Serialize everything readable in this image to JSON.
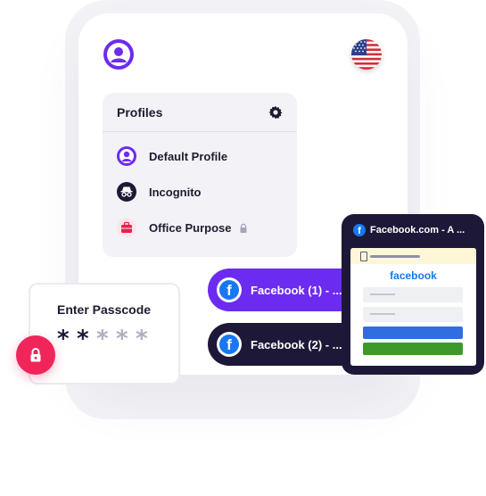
{
  "profiles": {
    "title": "Profiles",
    "items": [
      {
        "label": "Default Profile",
        "icon": "user-icon",
        "locked": false
      },
      {
        "label": "Incognito",
        "icon": "incognito-icon",
        "locked": false
      },
      {
        "label": "Office Purpose",
        "icon": "briefcase-icon",
        "locked": true
      }
    ]
  },
  "tabs": [
    {
      "label": "Facebook (1) - ...",
      "color": "#6c2bf0",
      "icon": "facebook-icon"
    },
    {
      "label": "Facebook (2) - ...",
      "color": "#1d1837",
      "icon": "facebook-icon"
    }
  ],
  "browser": {
    "tab_title": "Facebook.com - A ...",
    "logo_text": "facebook",
    "login_button_color": "#2f6de1",
    "signup_button_color": "#3d9a2a"
  },
  "passcode": {
    "title": "Enter Passcode",
    "dots": [
      "*",
      "*",
      "*",
      "*",
      "*"
    ],
    "filled": 2
  },
  "colors": {
    "accent": "#6c2bf0",
    "dark": "#1d1837",
    "danger": "#f0265a"
  }
}
